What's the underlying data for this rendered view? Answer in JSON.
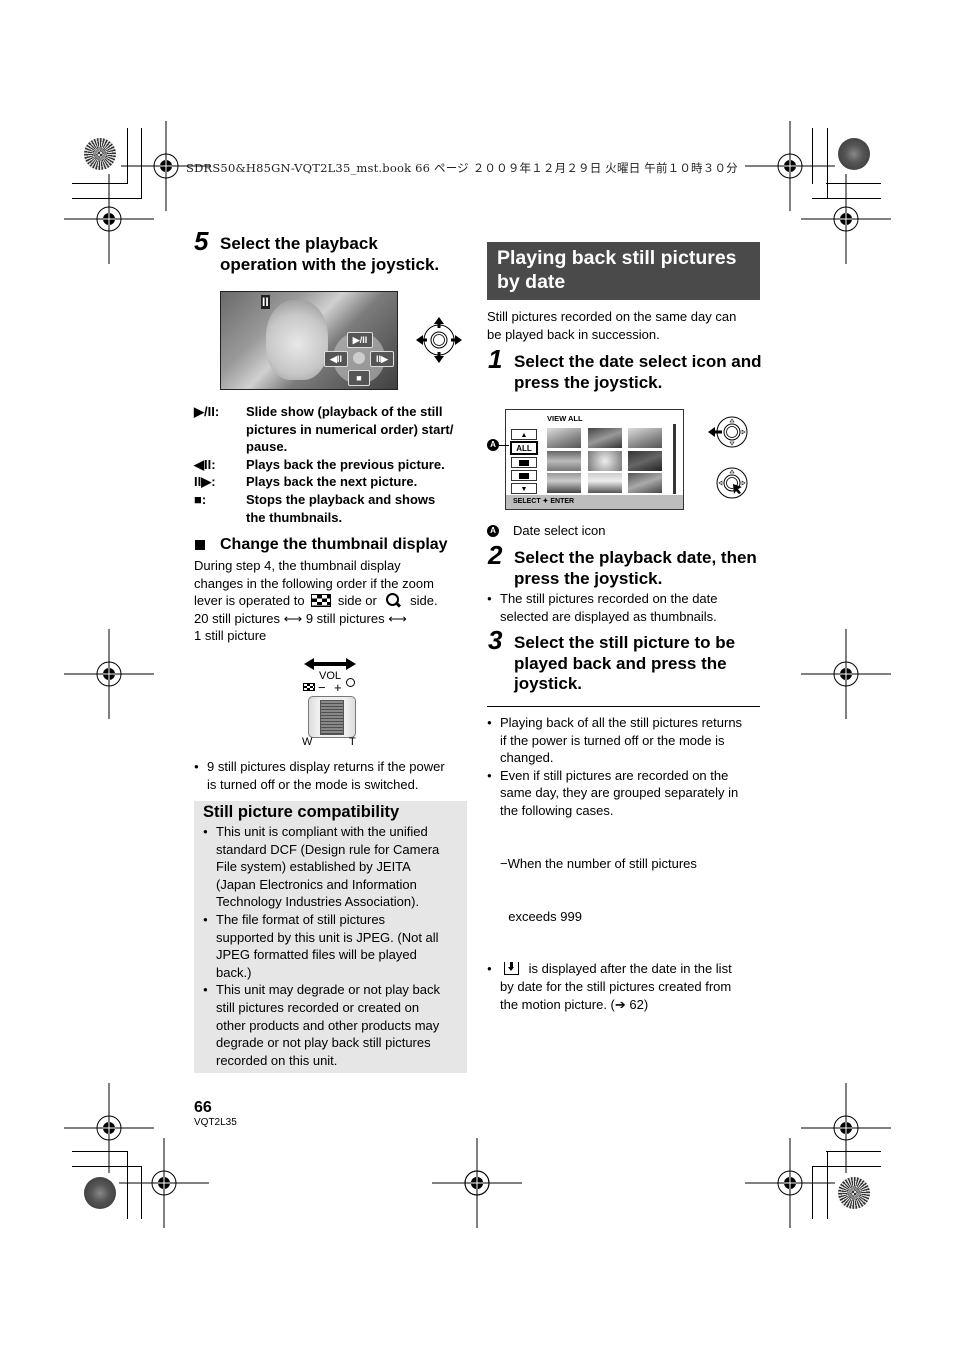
{
  "print_header": "SDRS50&H85GN-VQT2L35_mst.book  66 ページ  ２００９年１２月２９日  火曜日  午前１０時３０分",
  "left_column": {
    "step5": {
      "number": "5",
      "title_line1": "Select the playback",
      "title_line2": "operation with the joystick."
    },
    "photo_overlay": {
      "pause_icon": "II",
      "play_pause": "▶/II",
      "previous": "◀II",
      "next": "II▶",
      "stop": "■"
    },
    "controls": [
      {
        "key": "▶/II:",
        "desc_lines": [
          "Slide show (playback of the still",
          "pictures in numerical order) start/",
          "pause."
        ]
      },
      {
        "key": "◀II:",
        "desc_lines": [
          "Plays back the previous picture."
        ]
      },
      {
        "key": "II▶:",
        "desc_lines": [
          "Plays back the next picture."
        ]
      },
      {
        "key": "■:",
        "desc_lines": [
          "Stops the playback and shows",
          "the thumbnails."
        ]
      }
    ],
    "thumbnail_section": {
      "heading": "Change the thumbnail display",
      "line1": "During step 4, the thumbnail display",
      "line2": "changes in the following order if the zoom",
      "line3_a": "lever is operated to",
      "line3_b": "side or",
      "line3_c": "side.",
      "line4": "20 still pictures ⟷ 9 still pictures ⟷",
      "line5": "1 still picture"
    },
    "zoom_lever": {
      "vol_label": "VOL",
      "minus": "−",
      "plus": "+",
      "w_label": "W",
      "t_label": "T"
    },
    "note_lines": [
      "9 still pictures display returns if the power",
      "is turned off or the mode is switched."
    ],
    "compatibility": {
      "title": "Still picture compatibility",
      "bullets": [
        [
          "This unit is compliant with the unified",
          "standard DCF (Design rule for Camera",
          "File system) established by JEITA",
          "(Japan Electronics and Information",
          "Technology Industries Association)."
        ],
        [
          "The file format of still pictures",
          "supported by this unit is JPEG. (Not all",
          "JPEG formatted files will be played",
          "back.)"
        ],
        [
          "This unit may degrade or not play back",
          "still pictures recorded or created on",
          "other products and other products may",
          "degrade or not play back still pictures",
          "recorded on this unit."
        ]
      ]
    }
  },
  "right_column": {
    "banner_line1": "Playing back still pictures",
    "banner_line2": "by date",
    "intro_line1": "Still pictures recorded on the same day can",
    "intro_line2": "be played back in succession.",
    "step1": {
      "number": "1",
      "line1": "Select the date select icon and",
      "line2": "press the joystick."
    },
    "lcd": {
      "title": "VIEW ALL",
      "all_button": "ALL",
      "up": "▲",
      "down": "▼",
      "footer": "SELECT  ✦  ENTER"
    },
    "callout_letter": "A",
    "callout_text": "Date select icon",
    "step2": {
      "number": "2",
      "line1": "Select the playback date, then",
      "line2": "press the joystick."
    },
    "step2_bullet": [
      "The still pictures recorded on the date",
      "selected are displayed as thumbnails."
    ],
    "step3": {
      "number": "3",
      "line1": "Select the still picture to be",
      "line2": "played back and press the",
      "line3": "joystick."
    },
    "notes": [
      {
        "lines": [
          "Playing back of all the still pictures returns",
          "if the power is turned off or the mode is",
          "changed."
        ]
      },
      {
        "lines": [
          "Even if still pictures are recorded on the",
          "same day, they are grouped separately in",
          "the following cases."
        ]
      },
      {
        "dash_lines": [
          "−When the number of still pictures",
          "  exceeds 999"
        ]
      },
      {
        "lines_a": "is displayed after the date in the list",
        "lines": [
          "by date for the still pictures created from",
          "the motion picture. (➔ 62)"
        ]
      }
    ]
  },
  "footer": {
    "page_number": "66",
    "doc_code": "VQT2L35"
  }
}
